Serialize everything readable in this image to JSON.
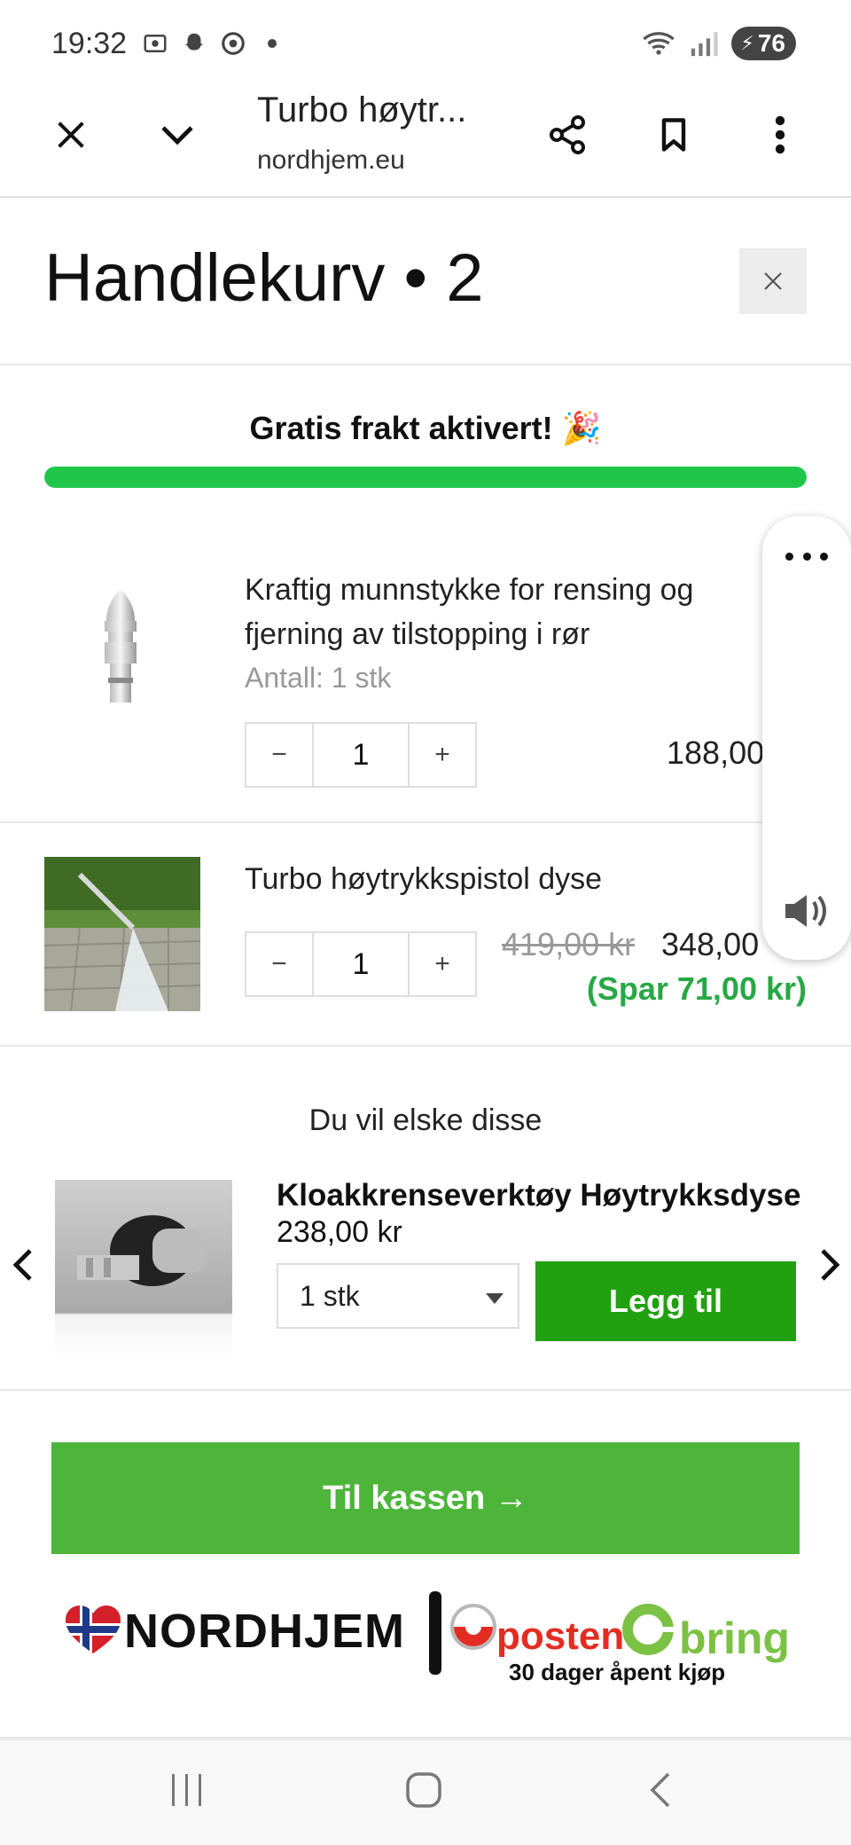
{
  "status_bar": {
    "time": "19:32",
    "battery": "76",
    "icons": [
      "screenshot-icon",
      "snapchat-icon",
      "chrome-icon",
      "wifi-icon",
      "signal-icon",
      "battery-icon"
    ]
  },
  "browser": {
    "title": "Turbo høytr...",
    "host": "nordhjem.eu"
  },
  "cart": {
    "title": "Handlekurv • 2",
    "free_shipping": "Gratis frakt aktivert! 🎉",
    "progress_fraction": 1.0,
    "items": [
      {
        "title_line1": "Kraftig munnstykke for rensing og",
        "title_line2": "fjerning av tilstopping i rør",
        "sub": "Antall: 1 stk",
        "qty": "1",
        "price": "188,00"
      },
      {
        "title_line1": "Turbo høytrykkspistol dyse",
        "qty": "1",
        "old_price": "419,00 kr",
        "price": "348,00",
        "save": "(Spar 71,00 kr)"
      }
    ],
    "qty_minus": "−",
    "qty_plus": "+"
  },
  "recommendations": {
    "heading": "Du vil elske disse",
    "product": {
      "title": "Kloakkrenseverktøy Høytrykksdyse",
      "price": "238,00 kr",
      "option": "1 stk",
      "add_label": "Legg til"
    }
  },
  "checkout": {
    "label": "Til kassen →"
  },
  "footer": {
    "brand": "NORDHJEM",
    "posten": "posten",
    "bring": "bring",
    "tagline": "30 dager åpent kjøp"
  },
  "colors": {
    "progress": "#1fc64a",
    "save_text": "#27a845",
    "add_button": "#21a010",
    "checkout": "#4cb53a"
  }
}
